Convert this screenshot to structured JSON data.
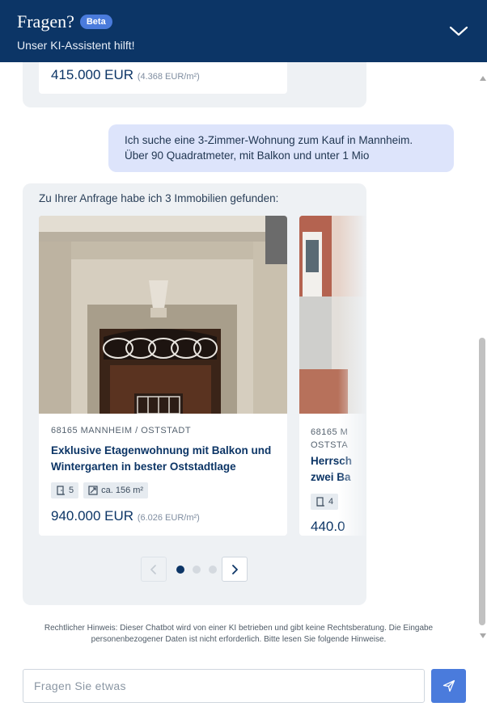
{
  "colors": {
    "header_bg": "#0c3566",
    "accent": "#4a7bdc",
    "bubble_bg": "#eef1f4",
    "user_bubble_bg": "#dde4fb"
  },
  "header": {
    "title": "Fragen?",
    "badge": "Beta",
    "subtitle": "Unser KI-Assistent hilft!",
    "collapse_icon": "chevron-down-icon"
  },
  "chat": {
    "previous_listing": {
      "price": "415.000 EUR",
      "price_per_sqm": "(4.368 EUR/m²)"
    },
    "user_message": "Ich suche eine 3-Zimmer-Wohnung zum Kauf in Mannheim. Über 90 Quadratmeter, mit Balkon und unter 1 Mio",
    "bot_intro": "Zu Ihrer Anfrage habe ich 3 Immobilien gefunden:",
    "listings": [
      {
        "location": "68165 MANNHEIM / OSTSTADT",
        "title": "Exklusive Etagenwohnung mit Balkon und Wintergarten in bester Oststadtlage",
        "rooms": "5",
        "area": "ca. 156 m²",
        "price": "940.000 EUR",
        "price_per_sqm": "(6.026 EUR/m²)"
      },
      {
        "location": "68165 M OSTSTA",
        "title": "Herrsch zwei Ba",
        "rooms": "4",
        "price": "440.0"
      }
    ],
    "carousel": {
      "pages": 3,
      "active_page": 1,
      "prev_icon": "chevron-left-icon",
      "next_icon": "chevron-right-icon"
    }
  },
  "disclaimer": "Rechtlicher Hinweis: Dieser Chatbot wird von einer KI betrieben und gibt keine Rechtsberatung. Die Eingabe personenbezogener Daten ist nicht erforderlich. Bitte lesen Sie   folgende Hinweise.",
  "input": {
    "placeholder": "Fragen Sie etwas",
    "value": "",
    "send_icon": "send-icon"
  }
}
